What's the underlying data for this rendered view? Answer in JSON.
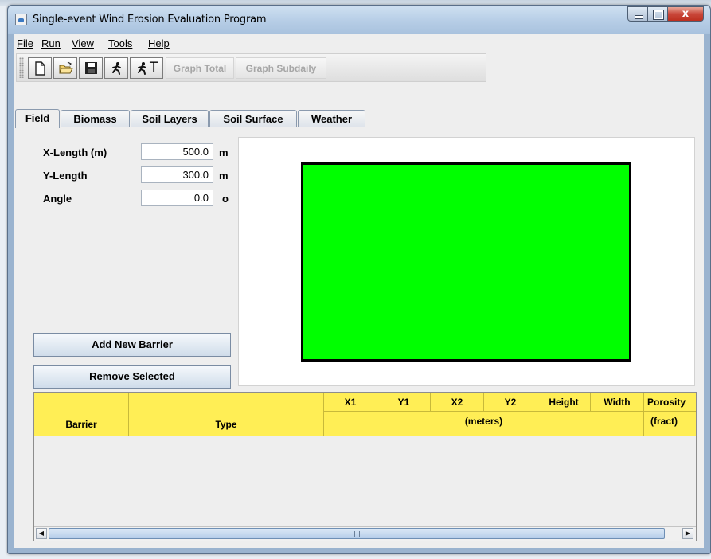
{
  "window": {
    "title": "Single-event Wind Erosion Evaluation Program",
    "close_glyph": "x"
  },
  "menu": [
    {
      "label": "File"
    },
    {
      "label": "Run"
    },
    {
      "label": "View"
    },
    {
      "label": "Tools"
    },
    {
      "label": "Help"
    }
  ],
  "toolbar": {
    "icons": [
      "new-file-icon",
      "open-folder-icon",
      "save-icon",
      "run-icon",
      "run-text-icon"
    ],
    "run_text_suffix": "T",
    "graph_total": "Graph Total",
    "graph_subdaily": "Graph Subdaily"
  },
  "tabs": [
    {
      "label": "Field",
      "active": true
    },
    {
      "label": "Biomass"
    },
    {
      "label": "Soil Layers"
    },
    {
      "label": "Soil Surface"
    },
    {
      "label": "Weather"
    }
  ],
  "fields": {
    "x_length": {
      "label": "X-Length (m)",
      "value": "500.0",
      "unit": "m"
    },
    "y_length": {
      "label": "Y-Length",
      "value": "300.0",
      "unit": "m"
    },
    "angle": {
      "label": "Angle",
      "value": "0.0",
      "unit": "o"
    }
  },
  "buttons": {
    "add_barrier": "Add New Barrier",
    "remove_selected": "Remove Selected"
  },
  "table": {
    "headers_top": [
      "X1",
      "Y1",
      "X2",
      "Y2",
      "Height",
      "Width",
      "Porosity"
    ],
    "headers_bottom": {
      "barrier": "Barrier",
      "type": "Type",
      "meters": "(meters)",
      "fract": "(fract)"
    },
    "rows": []
  },
  "colors": {
    "field_fill": "#00ff00",
    "table_header": "#ffee55"
  }
}
